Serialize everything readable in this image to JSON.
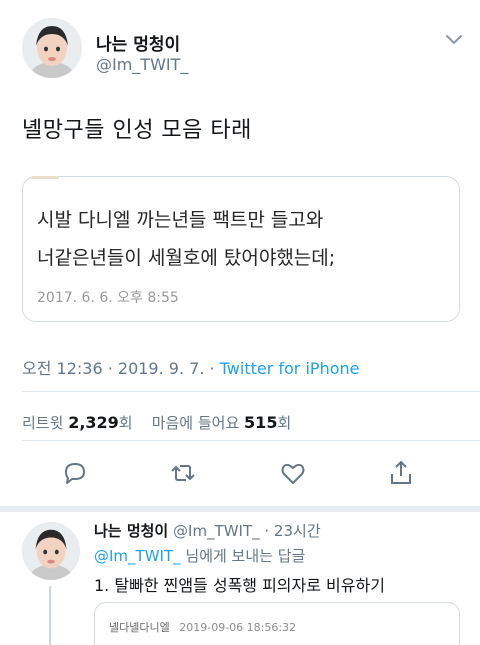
{
  "tweet": {
    "author_name": "나는 멍청이",
    "author_handle": "@Im_TWIT_",
    "text": "녤망구들 인성 모음 타래",
    "quote": {
      "line1": "시발 다니엘 까는년들 팩트만 들고와",
      "line2": "너같은년들이 세월호에 탔어야했는데;",
      "date": "2017. 6. 6. 오후 8:55"
    },
    "meta": {
      "time_date": "오전 12:36 · 2019. 9. 7. ·",
      "client": "Twitter for iPhone"
    },
    "stats": {
      "retweet_label": "리트윗",
      "retweet_count": "2,329",
      "retweet_unit": "회",
      "like_label": "마음에 들어요",
      "like_count": "515",
      "like_unit": "회"
    },
    "icons": [
      "reply-icon",
      "retweet-icon",
      "like-icon",
      "share-icon"
    ]
  },
  "reply": {
    "author_name": "나는 멍청이",
    "author_handle": "@Im_TWIT_ · 23시간",
    "mention": "@Im_TWIT_",
    "to_suffix": " 님에게 보내는 답글",
    "text": "1. 탈빠한 찐앰들 성폭행 피의자로 비유하기",
    "quote_name": "녤다녤다니엘",
    "quote_date": "2019-09-06 18:56:32"
  },
  "colors": {
    "accent": "#1da1f2",
    "secondary_text": "#657786",
    "border": "#d3dbe0"
  }
}
